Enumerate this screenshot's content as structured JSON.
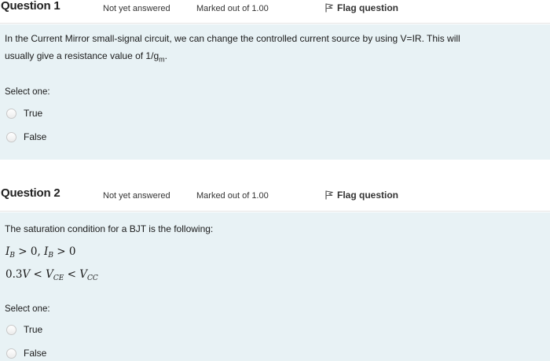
{
  "questions": [
    {
      "title": "Question 1",
      "status": "Not yet answered",
      "marks": "Marked out of 1.00",
      "flag_label": "Flag question",
      "text_line1": "In the Current Mirror small-signal circuit, we can change the controlled current source by using V=IR. This will",
      "text_line2": "usually give a resistance value of 1/g",
      "text_sub": "m",
      "text_end": ".",
      "select_label": "Select one:",
      "options": [
        "True",
        "False"
      ]
    },
    {
      "title": "Question 2",
      "status": "Not yet answered",
      "marks": "Marked out of 1.00",
      "flag_label": "Flag question",
      "text_line1": "The saturation condition for a BJT is the following:",
      "math_line1": "I_B > 0, I_B > 0",
      "math_line2": "0.3V < V_CE < V_CC",
      "select_label": "Select one:",
      "options": [
        "True",
        "False"
      ]
    }
  ],
  "colors": {
    "body_bg": "#e8f2f5",
    "header_bg": "#ffffff",
    "flag_icon": "#555555"
  },
  "icons": {
    "flag": "flag-icon",
    "radio": "radio-icon"
  }
}
